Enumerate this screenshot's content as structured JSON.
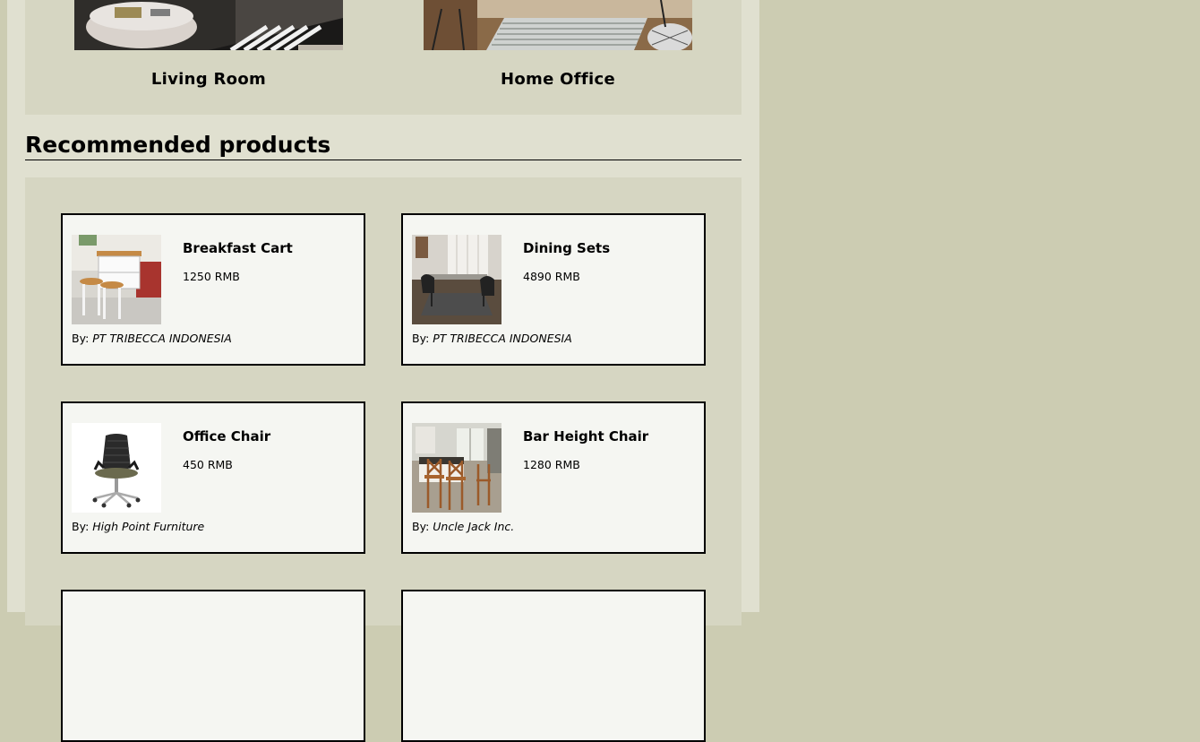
{
  "categories": [
    {
      "label": "Living Room"
    },
    {
      "label": "Home Office"
    }
  ],
  "section_title": "Recommended products",
  "by_prefix": "By:",
  "products": [
    {
      "name": "Breakfast Cart",
      "price": "1250 RMB",
      "maker": "PT TRIBECCA INDONESIA"
    },
    {
      "name": "Dining Sets",
      "price": "4890 RMB",
      "maker": "PT TRIBECCA INDONESIA"
    },
    {
      "name": "Office Chair",
      "price": "450 RMB",
      "maker": "High Point Furniture"
    },
    {
      "name": "Bar Height Chair",
      "price": "1280 RMB",
      "maker": "Uncle Jack Inc."
    }
  ]
}
